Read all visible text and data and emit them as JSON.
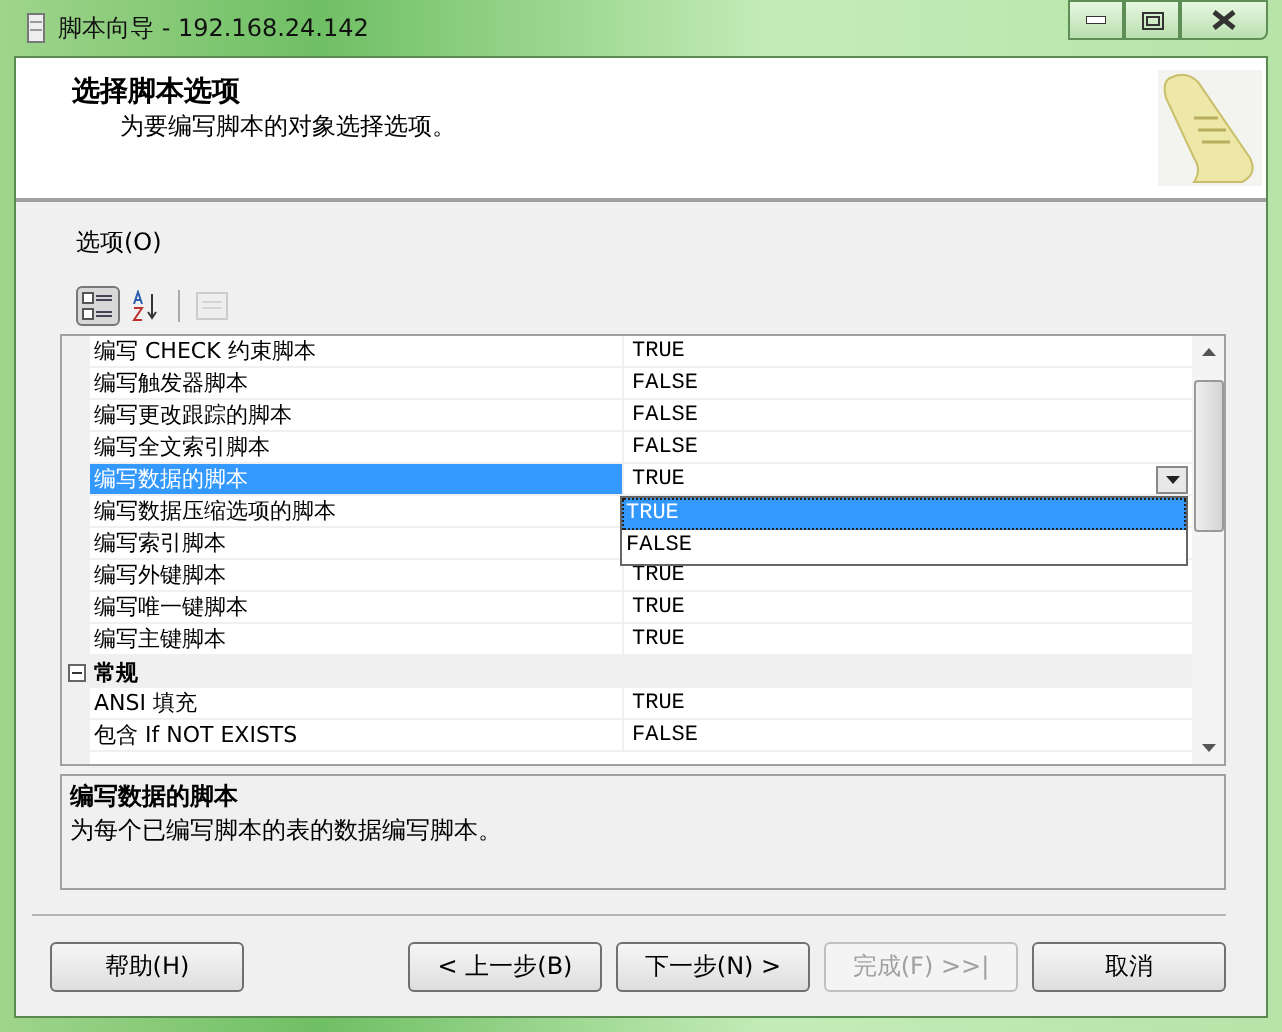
{
  "window": {
    "title": "脚本向导 - 192.168.24.142"
  },
  "header": {
    "title": "选择脚本选项",
    "subtitle": "为要编写脚本的对象选择选项。"
  },
  "options_label": "选项(O)",
  "toolbar": [
    {
      "kind": "categorized",
      "selected": true,
      "disabled": false
    },
    {
      "kind": "alphabetical",
      "selected": false,
      "disabled": false
    },
    {
      "kind": "property-pages",
      "selected": false,
      "disabled": true
    }
  ],
  "property_grid": {
    "items": [
      {
        "kind": "property",
        "name": "编写 CHECK 约束脚本",
        "value": "TRUE",
        "selected": false
      },
      {
        "kind": "property",
        "name": "编写触发器脚本",
        "value": "FALSE",
        "selected": false
      },
      {
        "kind": "property",
        "name": "编写更改跟踪的脚本",
        "value": "FALSE",
        "selected": false
      },
      {
        "kind": "property",
        "name": "编写全文索引脚本",
        "value": "FALSE",
        "selected": false
      },
      {
        "kind": "property",
        "name": "编写数据的脚本",
        "value": "TRUE",
        "selected": true
      },
      {
        "kind": "property",
        "name": "编写数据压缩选项的脚本",
        "selected": false
      },
      {
        "kind": "property",
        "name": "编写索引脚本",
        "selected": false
      },
      {
        "kind": "property",
        "name": "编写外键脚本",
        "value": "TRUE",
        "selected": false
      },
      {
        "kind": "property",
        "name": "编写唯一键脚本",
        "value": "TRUE",
        "selected": false
      },
      {
        "kind": "property",
        "name": "编写主键脚本",
        "value": "TRUE",
        "selected": false
      },
      {
        "kind": "category",
        "name": "常规",
        "expanded": true
      },
      {
        "kind": "property",
        "name": "ANSI 填充",
        "value": "TRUE",
        "selected": false
      },
      {
        "kind": "property",
        "name": "包含 If NOT EXISTS",
        "value": "FALSE",
        "selected": false
      }
    ],
    "dropdown": {
      "options": [
        {
          "label": "TRUE",
          "selected": true
        },
        {
          "label": "FALSE",
          "selected": false
        }
      ]
    }
  },
  "description": {
    "title": "编写数据的脚本",
    "text": "为每个已编写脚本的表的数据编写脚本。"
  },
  "buttons": [
    {
      "label": "帮助(H)",
      "disabled": false
    },
    {
      "label": "< 上一步(B)",
      "disabled": false
    },
    {
      "label": "下一步(N) >",
      "disabled": false
    },
    {
      "label": "完成(F) >>|",
      "disabled": true
    },
    {
      "label": "取消",
      "disabled": false
    }
  ]
}
